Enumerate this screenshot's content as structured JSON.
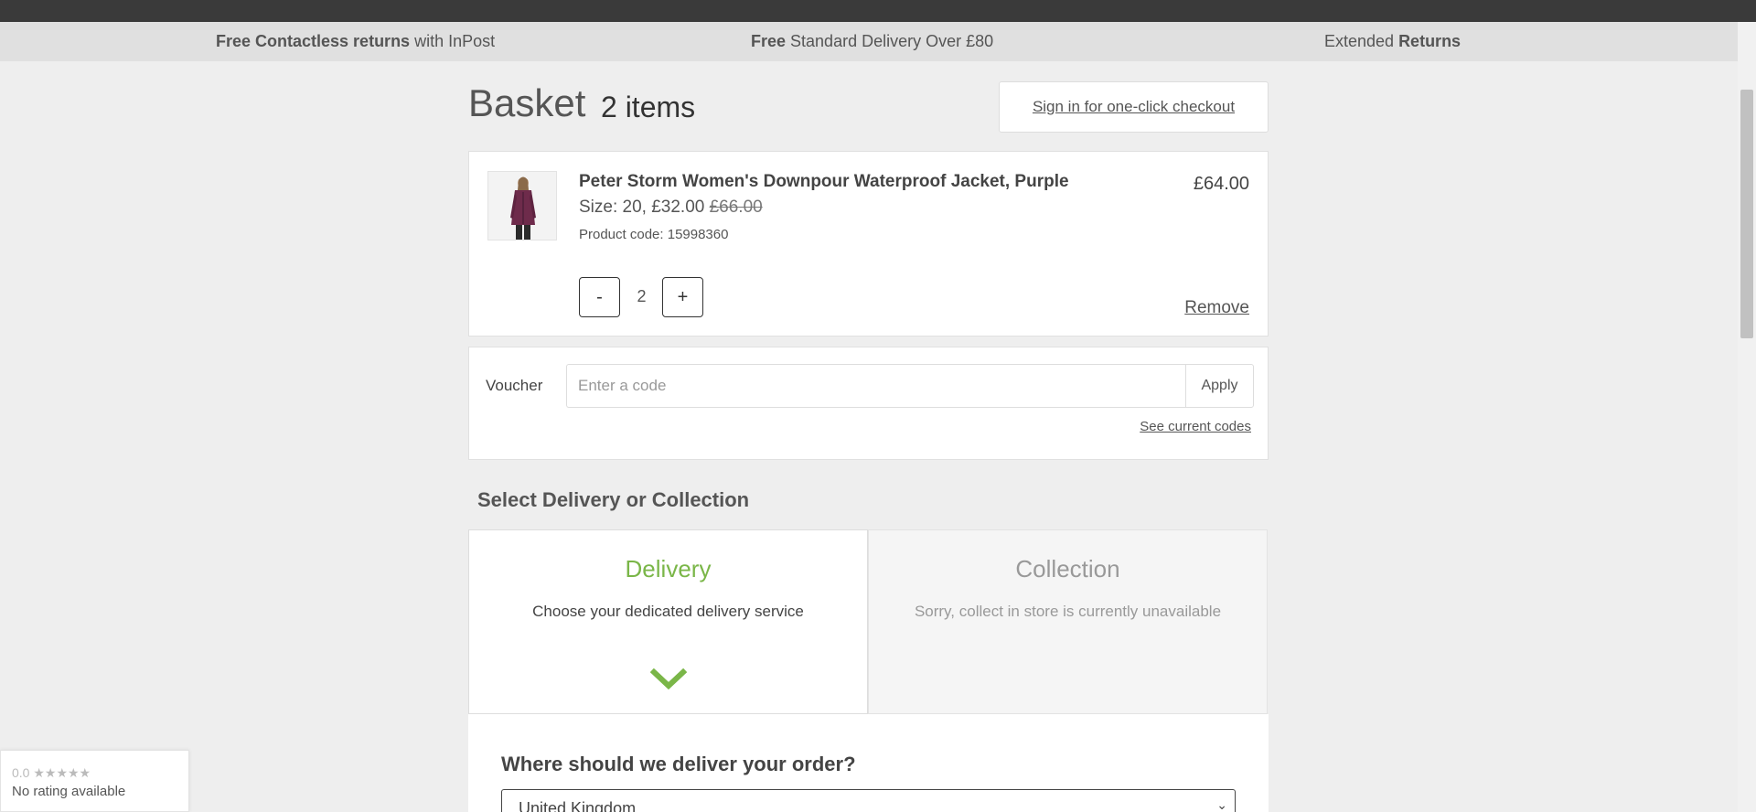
{
  "promo_bar": {
    "items": [
      {
        "bold": "Free Contactless returns",
        "rest": " with InPost"
      },
      {
        "bold": "Free",
        "rest": " Standard Delivery Over £80"
      },
      {
        "prefix": "Extended ",
        "bold": "Returns"
      }
    ]
  },
  "basket": {
    "title": "Basket",
    "count": "2 items",
    "signin_label": "Sign in for one-click checkout"
  },
  "item": {
    "name": "Peter Storm Women's Downpour Waterproof Jacket, Purple",
    "size_text": "Size: 20, £32.00",
    "was_price": "£66.00",
    "product_code": "Product code: 15998360",
    "line_total": "£64.00",
    "qty_minus": "-",
    "quantity": "2",
    "qty_plus": "+",
    "remove_label": "Remove",
    "image_icon": "product-photo-jacket"
  },
  "voucher": {
    "label": "Voucher",
    "placeholder": "Enter a code",
    "apply_label": "Apply",
    "see_codes_label": "See current codes"
  },
  "fulfilment": {
    "title": "Select Delivery or Collection",
    "delivery": {
      "title": "Delivery",
      "description": "Choose your dedicated delivery service",
      "selected": true
    },
    "collection": {
      "title": "Collection",
      "description": "Sorry, collect in store is currently unavailable"
    }
  },
  "address": {
    "question": "Where should we deliver your order?",
    "country": "United Kingdom"
  },
  "rating_widget": {
    "score": "0.0 ★★★★★",
    "text": "No rating available"
  },
  "colors": {
    "accent_green": "#7ab648",
    "top_bar": "#3a3a3a",
    "promo_bg": "#e0e0e0",
    "page_bg": "#eeeeee"
  }
}
